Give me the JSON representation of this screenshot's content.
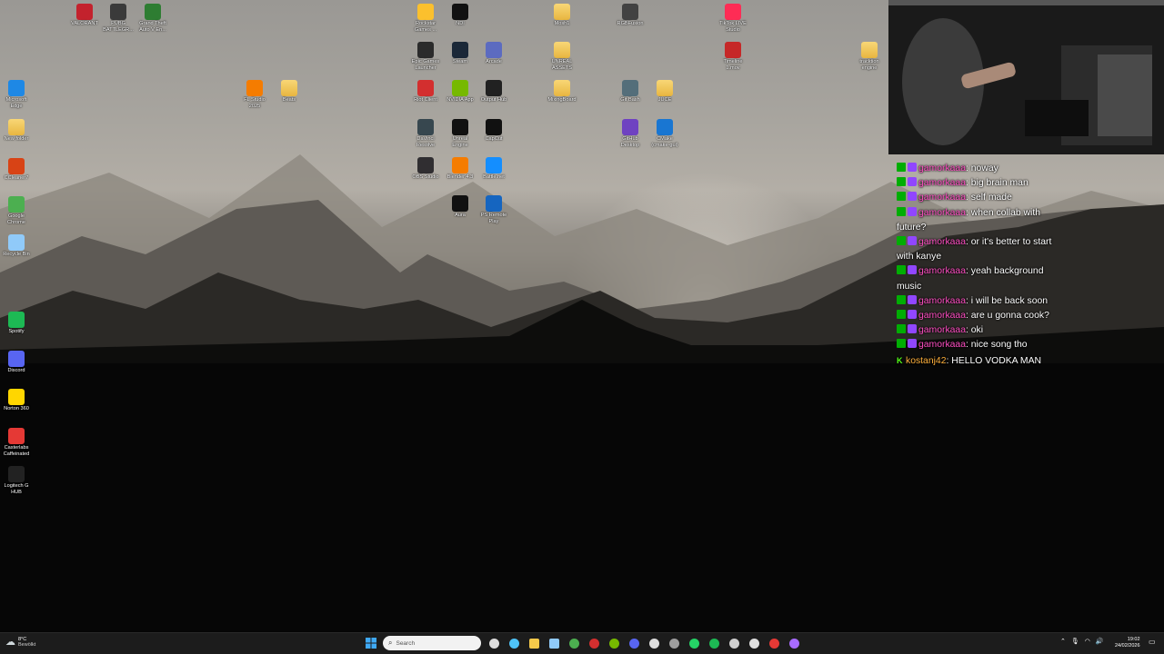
{
  "desktop": {
    "icons": [
      {
        "label": "VALORANT",
        "icon": "valorant-icon",
        "color": "#c3222d"
      },
      {
        "label": "PUBG\nBATTLEGR...",
        "icon": "pubg-icon",
        "color": "#3a3a3a"
      },
      {
        "label": "Grand Theft\nAuto V En...",
        "icon": "gta-icon",
        "color": "#2e7d32"
      },
      {
        "label": "Microsoft\nEdge",
        "icon": "edge-icon",
        "color": "#1e88e5"
      },
      {
        "label": "New folder",
        "icon": "folder-icon",
        "color": "#f5c94a"
      },
      {
        "label": "CCleaner7",
        "icon": "ccleaner-icon",
        "color": "#d84315"
      },
      {
        "label": "Google\nChrome",
        "icon": "chrome-icon",
        "color": "#4caf50"
      },
      {
        "label": "Recycle Bin",
        "icon": "recycle-bin-icon",
        "color": "#90caf9"
      },
      {
        "label": "Spotify",
        "icon": "spotify-icon",
        "color": "#1db954"
      },
      {
        "label": "Discord",
        "icon": "discord-icon",
        "color": "#5865f2"
      },
      {
        "label": "Norton 360",
        "icon": "norton-icon",
        "color": "#ffd600"
      },
      {
        "label": "Casterlabs\nCaffeinated",
        "icon": "casterlabs-icon",
        "color": "#e53935"
      },
      {
        "label": "Logitech G\nHUB",
        "icon": "logitech-icon",
        "color": "#222222"
      },
      {
        "label": "FL Studio\n2025",
        "icon": "fl-studio-icon",
        "color": "#f57c00"
      },
      {
        "label": "Beats",
        "icon": "folder-icon",
        "color": "#f5c94a"
      },
      {
        "label": "Rockstar\nGames ...",
        "icon": "rockstar-icon",
        "color": "#fbc02d"
      },
      {
        "label": "NDI",
        "icon": "ndi-icon",
        "color": "#111111"
      },
      {
        "label": "Epic Games\nLauncher",
        "icon": "epic-games-icon",
        "color": "#2b2b2b"
      },
      {
        "label": "Steam",
        "icon": "steam-icon",
        "color": "#1b2838"
      },
      {
        "label": "Arcade",
        "icon": "arcade-icon",
        "color": "#5c6bc0"
      },
      {
        "label": "Riot Client",
        "icon": "riot-icon",
        "color": "#d32f2f"
      },
      {
        "label": "NVIDIA App",
        "icon": "nvidia-icon",
        "color": "#76b900"
      },
      {
        "label": "Output Hub",
        "icon": "output-hub-icon",
        "color": "#212121"
      },
      {
        "label": "DaVinci\nResolve",
        "icon": "davinci-icon",
        "color": "#37474f"
      },
      {
        "label": "Unreal\nEngine",
        "icon": "unreal-icon",
        "color": "#111111"
      },
      {
        "label": "CapCut",
        "icon": "capcut-icon",
        "color": "#111111"
      },
      {
        "label": "OBS Studio",
        "icon": "obs-icon",
        "color": "#302e31"
      },
      {
        "label": "Blender 4.3",
        "icon": "blender-icon",
        "color": "#f57c00"
      },
      {
        "label": "Battle.net",
        "icon": "battlenet-icon",
        "color": "#148eff"
      },
      {
        "label": "Aura",
        "icon": "aura-icon",
        "color": "#111111"
      },
      {
        "label": "PS Remote\nPlay",
        "icon": "ps-remote-play-icon",
        "color": "#1565c0"
      },
      {
        "label": "Mosh1",
        "icon": "folder-icon",
        "color": "#f5c94a"
      },
      {
        "label": "UNREAL\nASSETS",
        "icon": "folder-icon",
        "color": "#f5c94a"
      },
      {
        "label": "MixingBoard",
        "icon": "folder-icon",
        "color": "#f5c94a"
      },
      {
        "label": "RGBFusion",
        "icon": "rgbfusion-icon",
        "color": "#424242"
      },
      {
        "label": "Git Bash",
        "icon": "git-bash-icon",
        "color": "#546e7a"
      },
      {
        "label": "JUCE",
        "icon": "folder-icon",
        "color": "#f5c94a"
      },
      {
        "label": "GitHub\nDesktop",
        "icon": "github-desktop-icon",
        "color": "#6f42c1"
      },
      {
        "label": "CMake\n(cmake-gui)",
        "icon": "cmake-icon",
        "color": "#1976d2"
      },
      {
        "label": "TikTok LIVE\nStudio",
        "icon": "tiktok-icon",
        "color": "#fe2c55"
      },
      {
        "label": "Timeline\n1.mov",
        "icon": "video-file-icon",
        "color": "#c62828"
      },
      {
        "label": "tracktion\nengine",
        "icon": "folder-icon",
        "color": "#f5c94a"
      }
    ]
  },
  "chat": {
    "messages": [
      {
        "user": "gamorkaaa",
        "text": "noway",
        "badges": [
          "green",
          "purple"
        ]
      },
      {
        "user": "gamorkaaa",
        "text": "big brain man",
        "badges": [
          "green",
          "purple"
        ]
      },
      {
        "user": "gamorkaaa",
        "text": "self made",
        "badges": [
          "green",
          "purple"
        ]
      },
      {
        "user": "gamorkaaa",
        "text": "when collab with future?",
        "badges": [
          "green",
          "purple"
        ]
      },
      {
        "user": "gamorkaaa",
        "text": "or it's better to start with kanye",
        "badges": [
          "green",
          "purple"
        ]
      },
      {
        "user": "gamorkaaa",
        "text": "yeah background music",
        "badges": [
          "green",
          "purple"
        ]
      },
      {
        "user": "gamorkaaa",
        "text": "i will be back soon",
        "badges": [
          "green",
          "purple"
        ]
      },
      {
        "user": "gamorkaaa",
        "text": "are u gonna cook?",
        "badges": [
          "green",
          "purple"
        ]
      },
      {
        "user": "gamorkaaa",
        "text": "oki",
        "badges": [
          "green",
          "purple"
        ]
      },
      {
        "user": "gamorkaaa",
        "text": "nice song tho",
        "badges": [
          "green",
          "purple"
        ]
      },
      {
        "user": "kostanj42",
        "text": "HELLO VODKA MAN",
        "badges": [
          "k"
        ]
      }
    ],
    "colors": {
      "gamorkaaa": "#ff4fc3",
      "kostanj42": "#ffb03b",
      "green_badge": "#00ad03",
      "purple_badge": "#9146ff"
    }
  },
  "taskbar": {
    "weather": {
      "temp": "8°C",
      "condition": "Bewölkt"
    },
    "search_placeholder": "Search",
    "apps": [
      "start-icon",
      "search-icon",
      "task-view-icon",
      "copilot-icon",
      "file-explorer-icon",
      "store-icon",
      "chrome-icon",
      "red-app-icon",
      "nvidia-icon",
      "discord-icon",
      "cursor-icon",
      "network-icon",
      "whatsapp-icon",
      "spotify-icon",
      "obs-icon",
      "github-icon",
      "casterlabs-icon",
      "visual-studio-icon"
    ],
    "clock": {
      "time": "19:02",
      "date": "24/02/2026"
    }
  }
}
